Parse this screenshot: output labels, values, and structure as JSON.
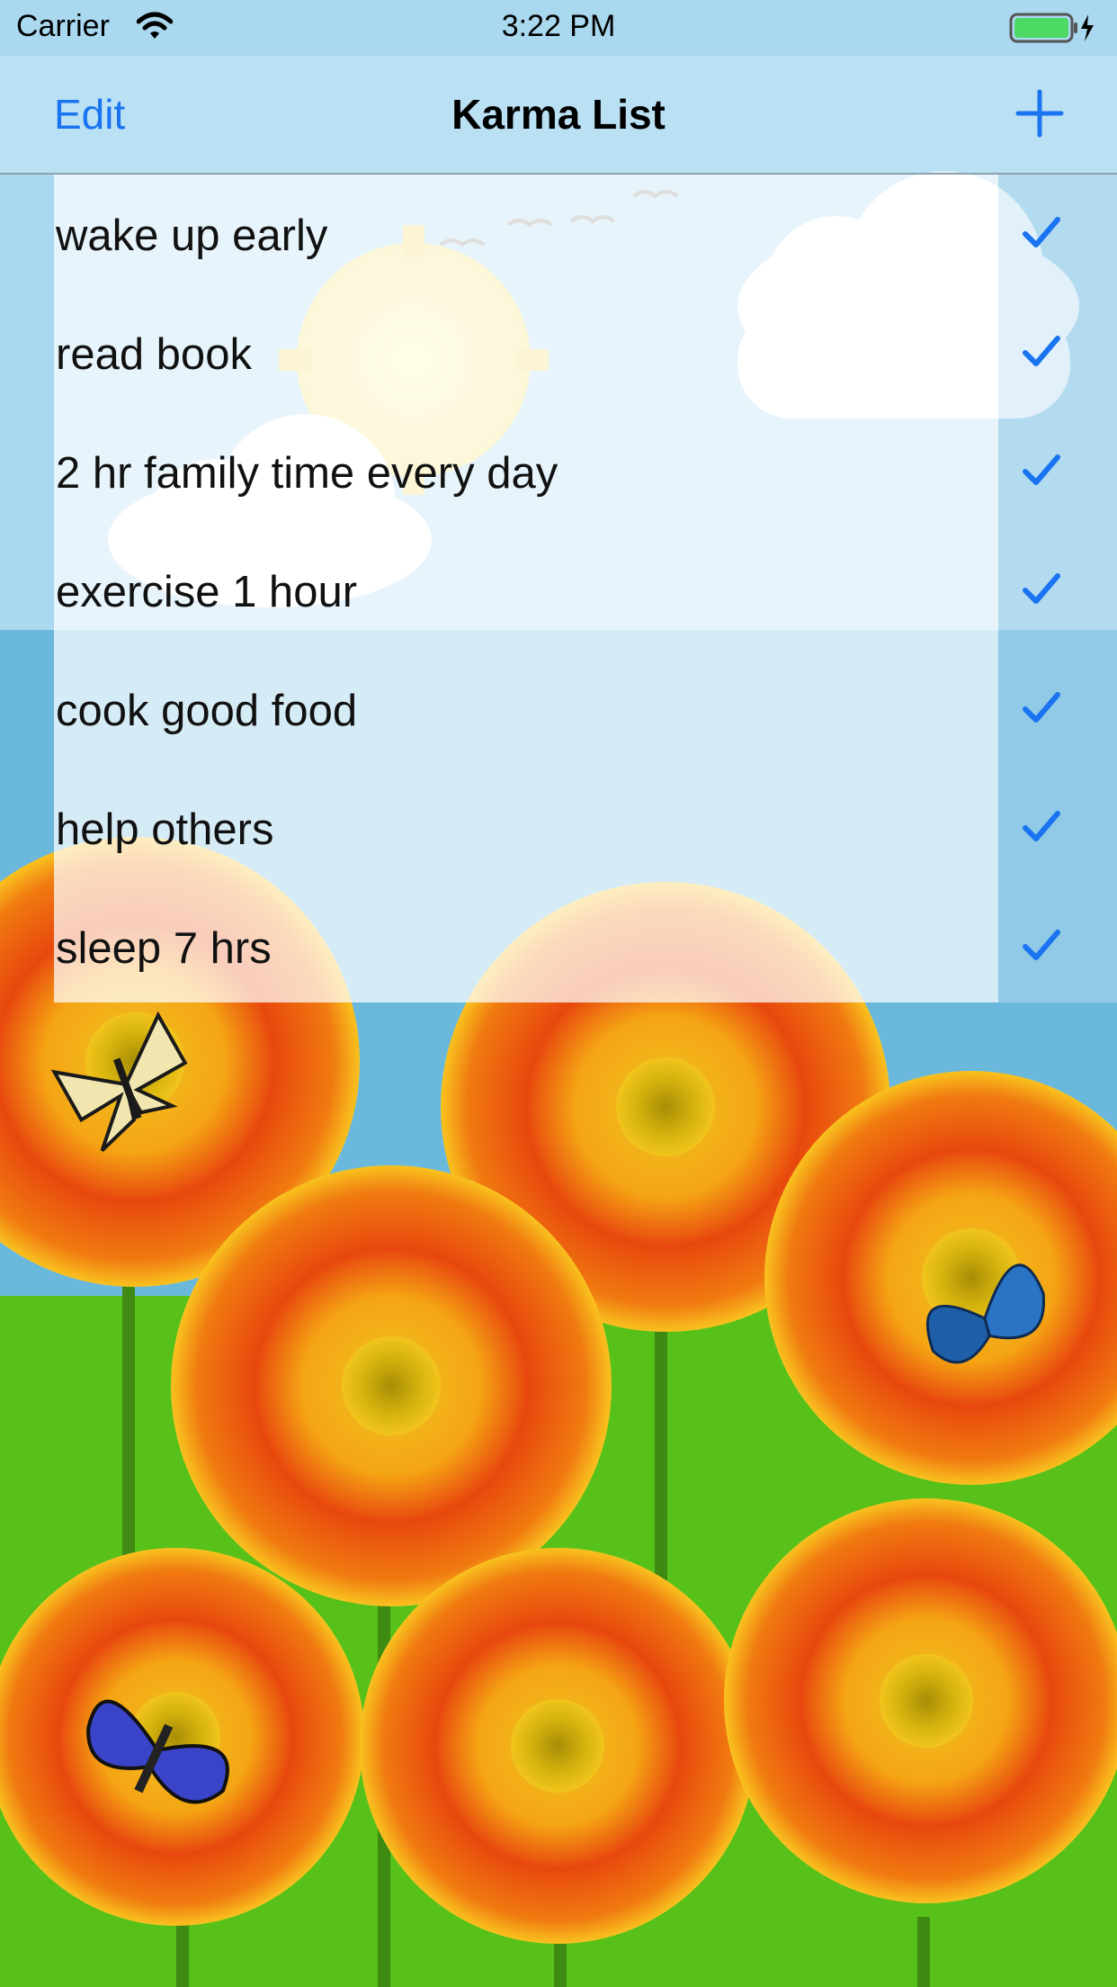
{
  "status_bar": {
    "carrier": "Carrier",
    "time": "3:22 PM"
  },
  "nav": {
    "edit_label": "Edit",
    "title": "Karma List",
    "add_icon": "plus-icon"
  },
  "items": [
    {
      "label": "wake up early",
      "checked": true
    },
    {
      "label": "read book",
      "checked": true
    },
    {
      "label": "2 hr family time every day",
      "checked": true
    },
    {
      "label": "exercise 1 hour",
      "checked": true
    },
    {
      "label": "cook good food",
      "checked": true
    },
    {
      "label": "help others",
      "checked": true
    },
    {
      "label": "sleep 7 hrs",
      "checked": true
    }
  ],
  "colors": {
    "accent": "#1a73f0",
    "sky": "#6ab8dc",
    "grass": "#57c11a",
    "flower_outer": "#e8420c",
    "flower_inner": "#f7a214"
  }
}
